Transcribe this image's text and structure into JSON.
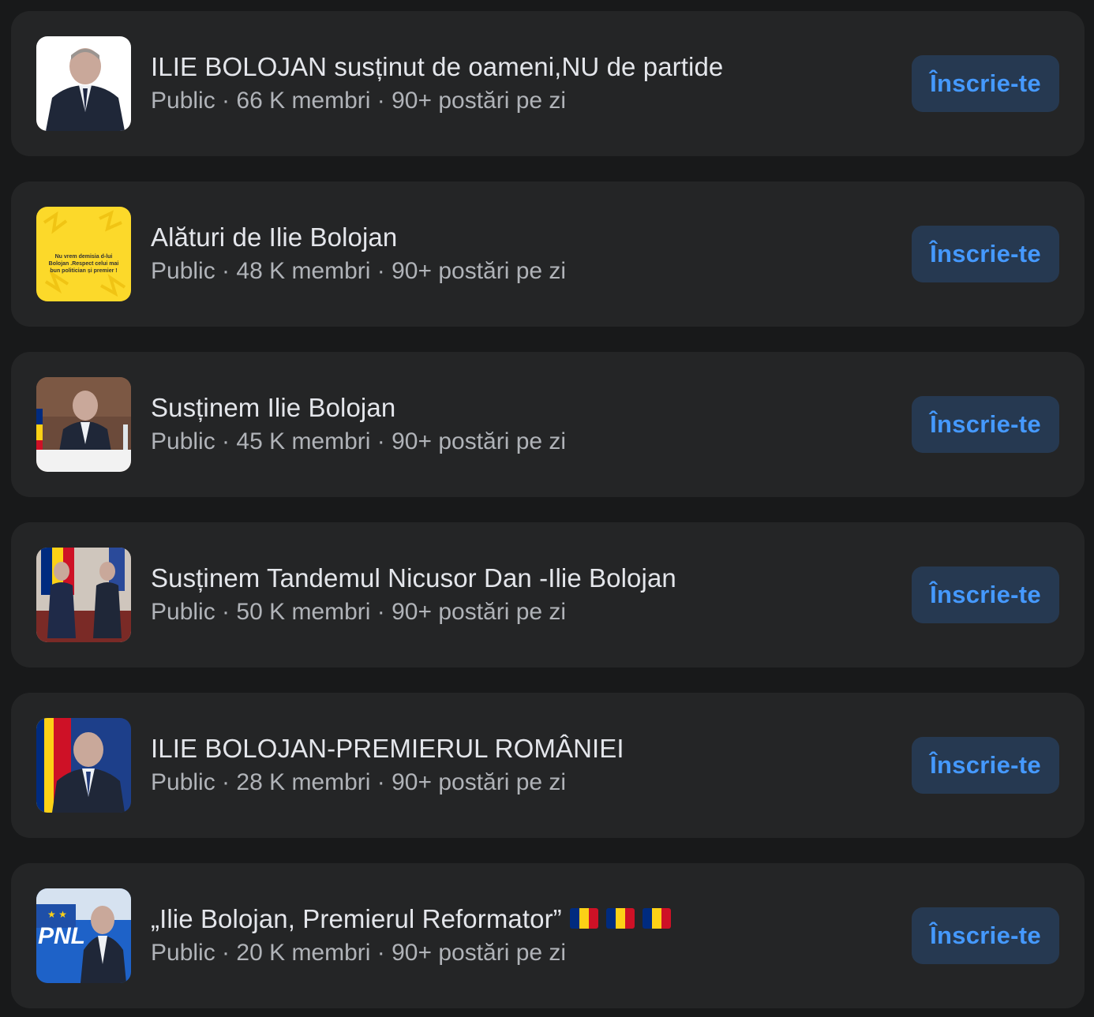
{
  "groups": [
    {
      "name": "ILIE BOLOJAN susținut de oameni,NU de partide",
      "privacy": "Public",
      "members": "66 K membri",
      "activity": "90+ postări pe zi",
      "join_label": "Înscrie-te"
    },
    {
      "name": "Alături de Ilie Bolojan",
      "privacy": "Public",
      "members": "48 K membri",
      "activity": "90+ postări pe zi",
      "join_label": "Înscrie-te",
      "thumb_text": "Nu vrem demisia d-lui Bolojan .Respect celui mai bun politician și premier !"
    },
    {
      "name": "Susținem Ilie Bolojan",
      "privacy": "Public",
      "members": "45 K membri",
      "activity": "90+ postări pe zi",
      "join_label": "Înscrie-te"
    },
    {
      "name": "Susținem Tandemul Nicusor Dan -Ilie Bolojan",
      "privacy": "Public",
      "members": "50 K membri",
      "activity": "90+ postări pe zi",
      "join_label": "Înscrie-te"
    },
    {
      "name": "ILIE BOLOJAN-PREMIERUL ROMÂNIEI",
      "privacy": "Public",
      "members": "28 K membri",
      "activity": "90+ postări pe zi",
      "join_label": "Înscrie-te"
    },
    {
      "name": "„Ilie Bolojan, Premierul Reformator”",
      "privacy": "Public",
      "members": "20 K membri",
      "activity": "90+ postări pe zi",
      "join_label": "Înscrie-te",
      "thumb_text": "PNL"
    }
  ],
  "separator": " · ",
  "colors": {
    "background": "#18191a",
    "card": "#242526",
    "button_bg": "#263951",
    "button_text": "#4599ff",
    "title": "#e4e6eb",
    "meta": "#b0b3b8"
  }
}
